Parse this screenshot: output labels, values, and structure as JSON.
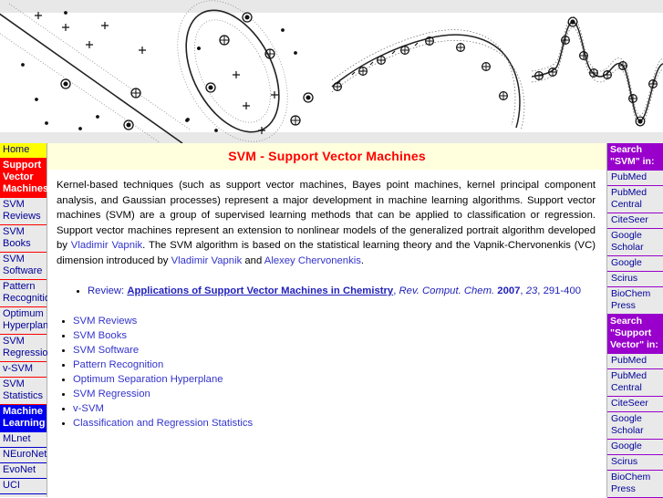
{
  "banner": {
    "alt": "svm-decision-boundary-banner"
  },
  "left_nav": {
    "items": [
      {
        "label": "Home",
        "style": "home"
      },
      {
        "label": "Support Vector Machines",
        "style": "current"
      },
      {
        "label": "SVM Reviews",
        "style": "normal"
      },
      {
        "label": "SVM Books",
        "style": "normal"
      },
      {
        "label": "SVM Software",
        "style": "normal"
      },
      {
        "label": "Pattern Recognition",
        "style": "normal"
      },
      {
        "label": "Optimum Hyperplane",
        "style": "normal"
      },
      {
        "label": "SVM Regression",
        "style": "normal"
      },
      {
        "label": "v-SVM",
        "style": "normal"
      },
      {
        "label": "SVM Statistics",
        "style": "normal"
      },
      {
        "label": "Machine Learning",
        "style": "ml"
      },
      {
        "label": "MLnet",
        "style": "blue-sep"
      },
      {
        "label": "NEuroNet",
        "style": "blue-sep"
      },
      {
        "label": "EvoNet",
        "style": "blue-sep"
      },
      {
        "label": "UCI",
        "style": "blue-sep"
      }
    ]
  },
  "main": {
    "title": "SVM - Support Vector Machines",
    "intro": {
      "part1": "Kernel-based techniques (such as support vector machines, Bayes point machines, kernel principal component analysis, and Gaussian processes) represent a major development in machine learning algorithms. Support vector machines (SVM) are a group of supervised learning methods that can be applied to classification or regression. Support vector machines represent an extension to nonlinear models of the generalized portrait algorithm developed by ",
      "link1": "Vladimir Vapnik",
      "part2": ". The SVM algorithm is based on the statistical learning theory and the Vapnik-Chervonenkis (VC) dimension introduced by ",
      "link2": "Vladimir Vapnik",
      "part3": " and ",
      "link3": "Alexey Chervonenkis",
      "part4": "."
    },
    "review": {
      "label": "Review: ",
      "title": "Applications of Support Vector Machines in Chemistry",
      "sep1": ", ",
      "journal": "Rev. Comput. Chem.",
      "sep2": " ",
      "year": "2007",
      "sep3": ", ",
      "volume": "23",
      "sep4": ", ",
      "pages": "291-400"
    },
    "topics": [
      "SVM Reviews",
      "SVM Books",
      "SVM Software",
      "Pattern Recognition",
      "Optimum Separation Hyperplane",
      "SVM Regression",
      "v-SVM",
      "Classification and Regression Statistics"
    ]
  },
  "right_nav": {
    "groups": [
      {
        "heading": "Search \"SVM\" in:",
        "items": [
          "PubMed",
          "PubMed Central",
          "CiteSeer",
          "Google Scholar",
          "Google",
          "Scirus",
          "BioChem Press"
        ]
      },
      {
        "heading": "Search \"Support Vector\" in:",
        "items": [
          "PubMed",
          "PubMed Central",
          "CiteSeer",
          "Google Scholar",
          "Google",
          "Scirus",
          "BioChem Press"
        ]
      }
    ]
  },
  "colors": {
    "accent_red": "#ff0000",
    "accent_blue": "#0000ee",
    "accent_purple": "#9900cc",
    "link": "#3333cc",
    "title_bg": "#ffffdd",
    "nav_bg": "#e9e9e9",
    "banner_bg": "#e8e8e8"
  }
}
